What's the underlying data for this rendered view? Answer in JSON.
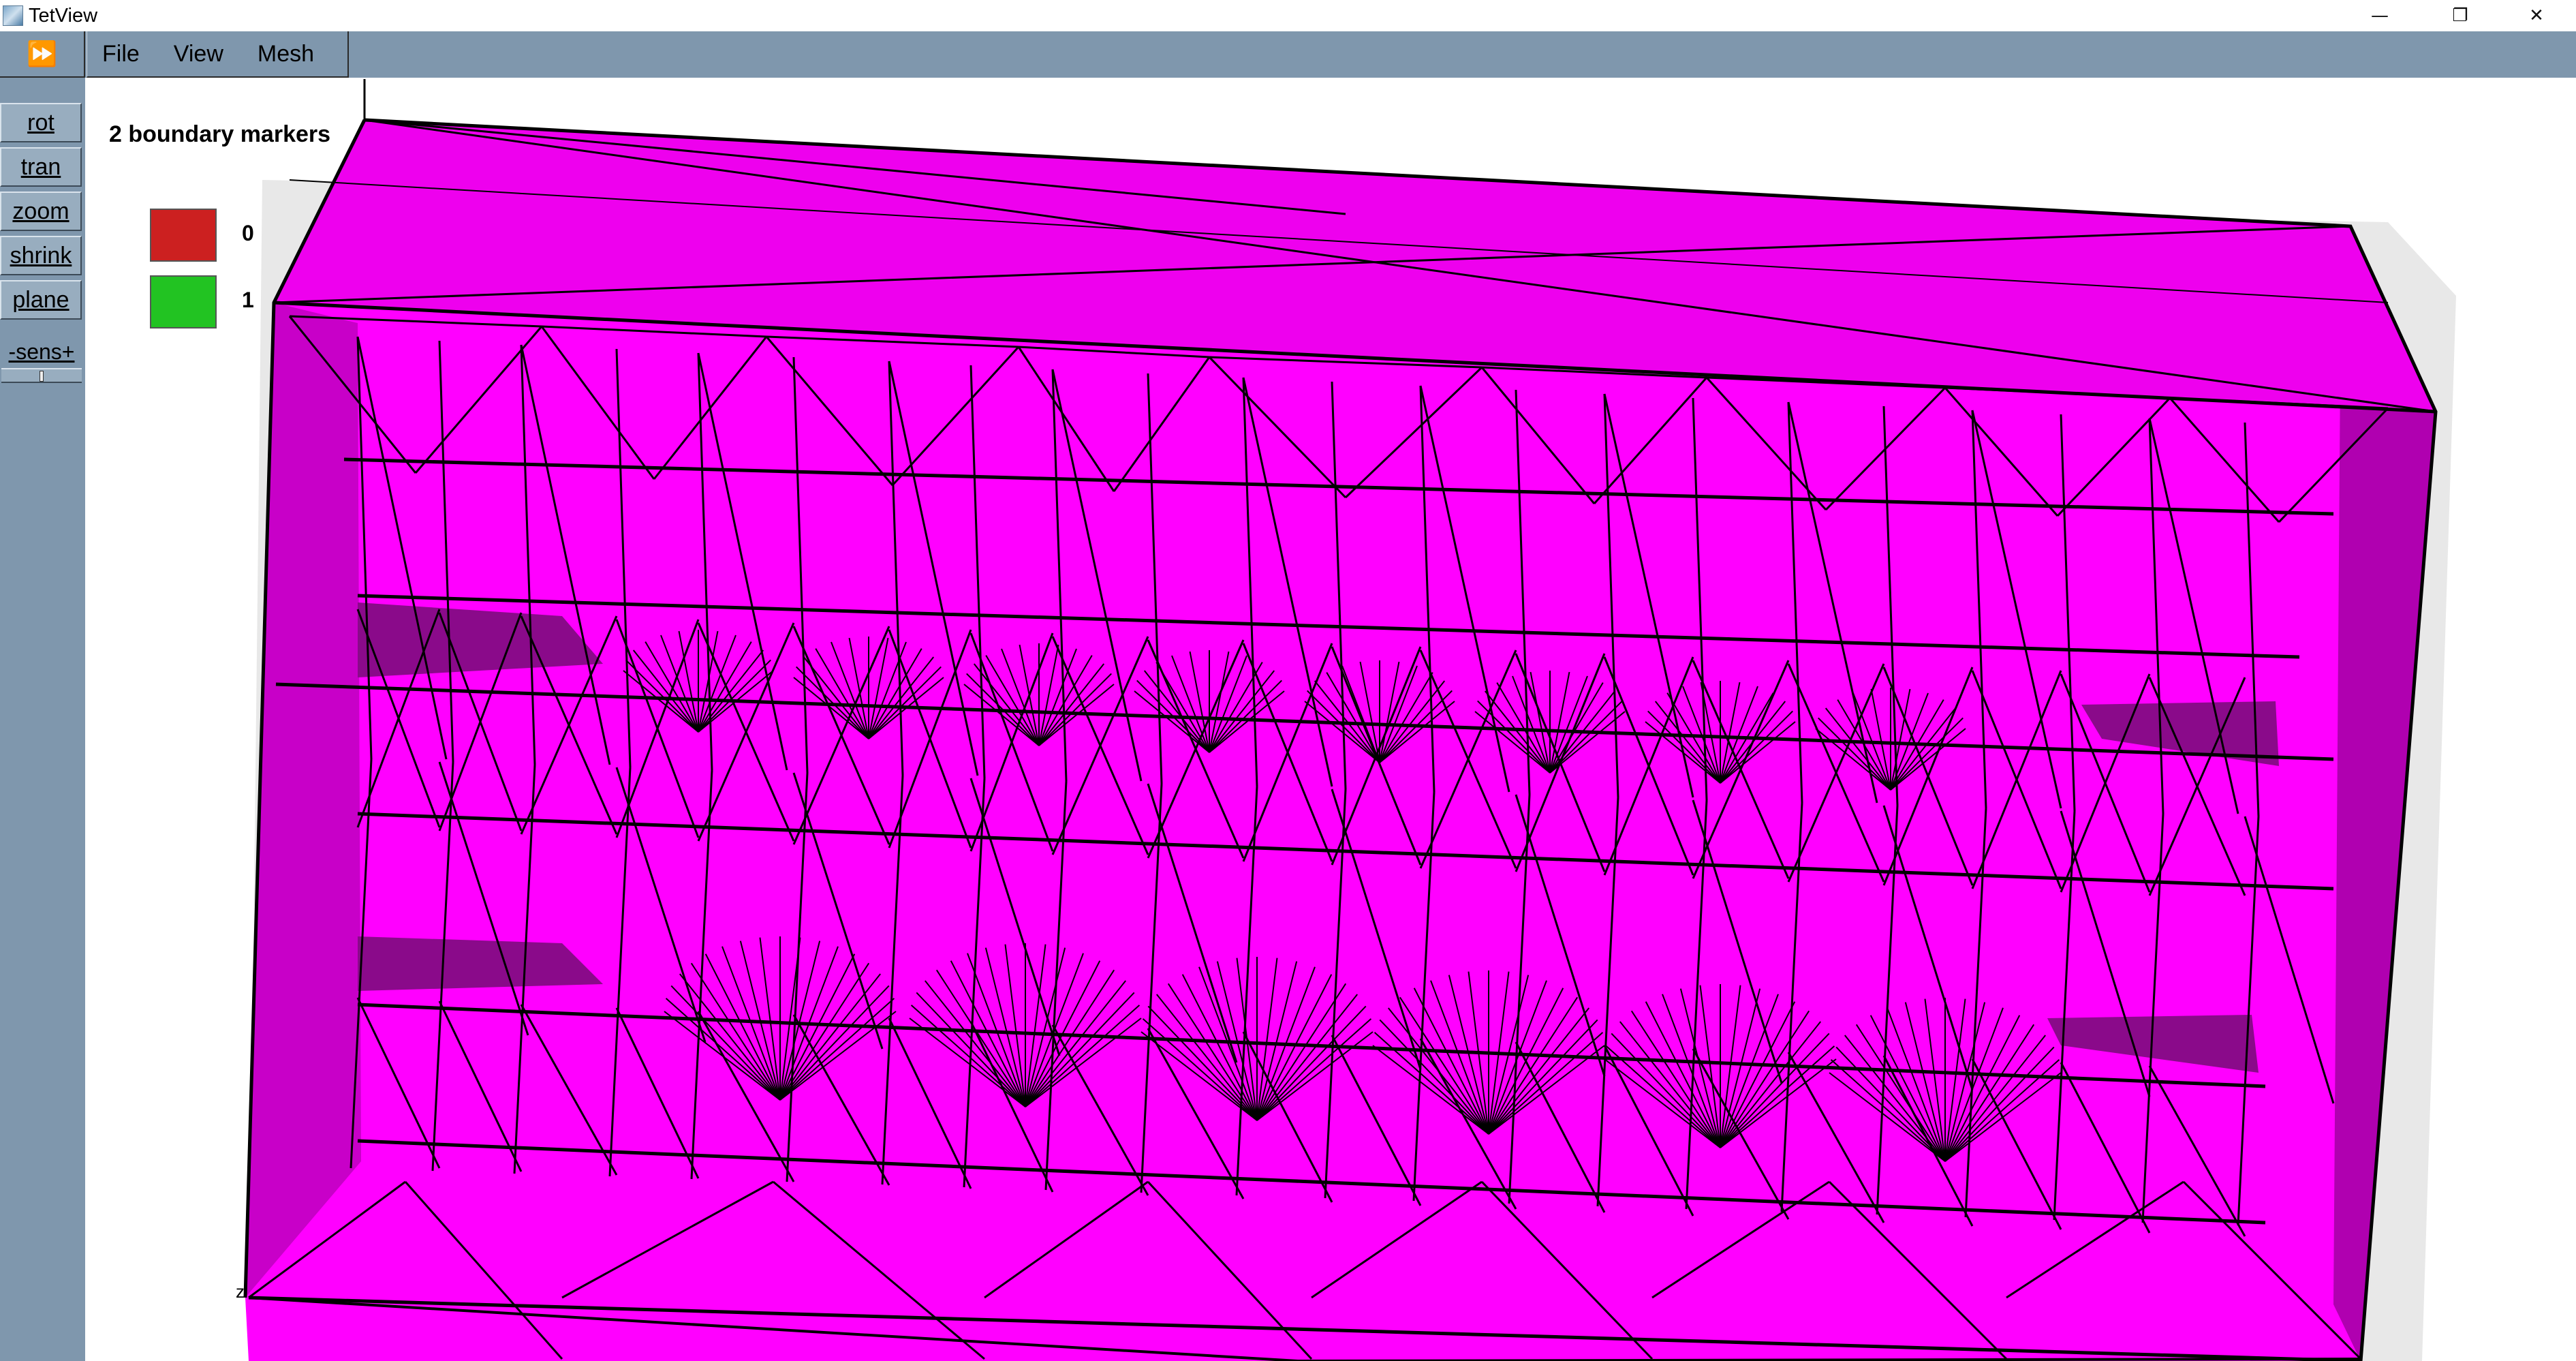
{
  "window": {
    "title": "TetView",
    "minimize_glyph": "—",
    "restore_glyph": "❐",
    "close_glyph": "✕"
  },
  "toolbar": {
    "toggle_glyph": "⏩",
    "buttons": [
      {
        "label": "rot"
      },
      {
        "label": "tran"
      },
      {
        "label": "zoom"
      },
      {
        "label": "shrink"
      },
      {
        "label": "plane"
      }
    ],
    "sensitivity_label": "-sens+",
    "sensitivity_level": 0.5
  },
  "menubar": {
    "items": [
      {
        "label": "File"
      },
      {
        "label": "View"
      },
      {
        "label": "Mesh"
      }
    ]
  },
  "legend": {
    "title": "2 boundary markers",
    "entries": [
      {
        "label": "0",
        "color": "#cc2020"
      },
      {
        "label": "1",
        "color": "#22c322"
      }
    ]
  },
  "viewport": {
    "axis_label": "z",
    "mesh_color": "#ff00ff",
    "mesh_shade_color": "#c400c4",
    "top_face_color": "#00f0f0",
    "edge_color": "#000000"
  }
}
